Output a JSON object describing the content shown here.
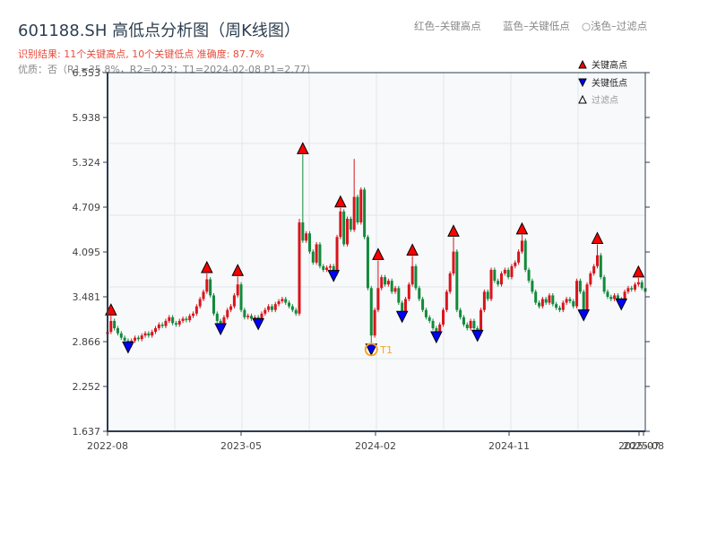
{
  "header": {
    "title": "601188.SH 高低点分析图（周K线图）",
    "result_line": "识别结果: 11个关键高点, 10个关键低点   准确度: 87.7%",
    "quality_line": "优质：否（R1=35.8%，R2=0.23；T1=2024-02-08 P1=2.77）",
    "hint_red": "红色–关键高点",
    "hint_blue": "蓝色–关键低点",
    "hint_filtered": "○浅色–过滤点"
  },
  "legend": {
    "placement": "top-right",
    "items": [
      {
        "label": "关键高点",
        "color": "#ff0000",
        "shape": "triangle-up"
      },
      {
        "label": "关键低点",
        "color": "#0000ff",
        "shape": "triangle-down"
      },
      {
        "label": "过滤点",
        "color": "#ffffff",
        "shape": "triangle-up-outline"
      }
    ]
  },
  "colors": {
    "up": "#d9141c",
    "down": "#128a3a",
    "high_marker": "#ff0000",
    "low_marker": "#0000ff",
    "t1": "#f5a623",
    "axis": "#2c3e50",
    "plot_bg": "#f7f9fb",
    "grid": "#e3e6ea"
  },
  "chart_data": {
    "type": "candlestick",
    "frequency": "weekly",
    "first_week": "2022-08-01",
    "ylim": [
      1.637,
      6.553
    ],
    "yticks": [
      "6.553",
      "5.938",
      "5.324",
      "4.709",
      "4.095",
      "3.481",
      "2.866",
      "2.252",
      "1.637"
    ],
    "xticks": [
      "2022-08",
      "2023-05",
      "2024-02",
      "2024-11",
      "2025-07",
      "2025-08"
    ],
    "grid": true,
    "closes": [
      3.0,
      3.15,
      3.05,
      2.98,
      2.92,
      2.88,
      2.82,
      2.88,
      2.92,
      2.9,
      2.95,
      2.98,
      2.95,
      3.0,
      3.05,
      3.1,
      3.08,
      3.15,
      3.2,
      3.12,
      3.1,
      3.15,
      3.18,
      3.16,
      3.22,
      3.25,
      3.35,
      3.45,
      3.55,
      3.72,
      3.5,
      3.25,
      3.15,
      3.08,
      3.2,
      3.3,
      3.35,
      3.5,
      3.65,
      3.3,
      3.2,
      3.22,
      3.18,
      3.2,
      3.15,
      3.25,
      3.3,
      3.35,
      3.3,
      3.38,
      3.42,
      3.45,
      3.4,
      3.35,
      3.3,
      3.25,
      4.5,
      4.25,
      4.35,
      4.1,
      3.95,
      4.2,
      3.9,
      3.85,
      3.88,
      3.9,
      3.8,
      4.3,
      4.65,
      4.2,
      4.55,
      4.4,
      4.85,
      4.5,
      4.95,
      4.3,
      3.6,
      2.95,
      3.3,
      3.6,
      3.75,
      3.65,
      3.7,
      3.55,
      3.6,
      3.4,
      3.25,
      3.45,
      3.65,
      3.9,
      3.6,
      3.45,
      3.3,
      3.2,
      3.15,
      3.05,
      2.98,
      3.1,
      3.3,
      3.55,
      3.8,
      4.1,
      3.3,
      3.2,
      3.1,
      3.05,
      3.15,
      3.05,
      2.98,
      3.3,
      3.55,
      3.45,
      3.85,
      3.7,
      3.65,
      3.8,
      3.85,
      3.75,
      3.9,
      3.95,
      4.1,
      4.25,
      3.85,
      3.7,
      3.55,
      3.4,
      3.35,
      3.45,
      3.4,
      3.5,
      3.38,
      3.33,
      3.3,
      3.4,
      3.45,
      3.42,
      3.35,
      3.7,
      3.55,
      3.3,
      3.65,
      3.8,
      3.9,
      4.05,
      3.75,
      3.55,
      3.48,
      3.45,
      3.5,
      3.45,
      3.42,
      3.55,
      3.6,
      3.58,
      3.65,
      3.68,
      3.6,
      3.55
    ],
    "key_highs": [
      {
        "bar": 1,
        "price": 3.22
      },
      {
        "bar": 29,
        "price": 3.8
      },
      {
        "bar": 38,
        "price": 3.76
      },
      {
        "bar": 57,
        "price": 5.43
      },
      {
        "bar": 68,
        "price": 4.7
      },
      {
        "bar": 79,
        "price": 3.98
      },
      {
        "bar": 89,
        "price": 4.04
      },
      {
        "bar": 101,
        "price": 4.3
      },
      {
        "bar": 121,
        "price": 4.33
      },
      {
        "bar": 143,
        "price": 4.2
      },
      {
        "bar": 155,
        "price": 3.74
      }
    ],
    "key_lows": [
      {
        "bar": 6,
        "price": 2.8
      },
      {
        "bar": 33,
        "price": 3.05
      },
      {
        "bar": 44,
        "price": 3.12
      },
      {
        "bar": 66,
        "price": 3.78
      },
      {
        "bar": 77,
        "price": 2.77
      },
      {
        "bar": 86,
        "price": 3.22
      },
      {
        "bar": 96,
        "price": 2.94
      },
      {
        "bar": 108,
        "price": 2.96
      },
      {
        "bar": 139,
        "price": 3.24
      },
      {
        "bar": 150,
        "price": 3.39
      }
    ],
    "extra_highs": [
      {
        "bar": 72,
        "price": 5.37
      },
      {
        "bar": 56,
        "price": 4.55
      }
    ],
    "annotation": {
      "label": "T1",
      "bar": 77
    }
  }
}
